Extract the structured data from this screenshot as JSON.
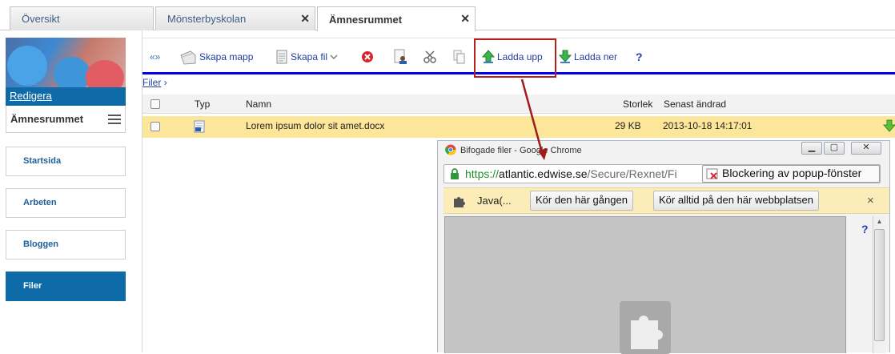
{
  "tabs": [
    {
      "label": "Översikt",
      "closable": false,
      "active": false
    },
    {
      "label": "Mönsterbyskolan",
      "closable": true,
      "active": false
    },
    {
      "label": "Ämnesrummet",
      "closable": true,
      "active": true
    }
  ],
  "tab_close_glyph": "✕",
  "sidebar": {
    "edit_label": "Redigera",
    "room_name": "Ämnesrummet",
    "nav": [
      {
        "label": "Startsida",
        "active": false
      },
      {
        "label": "Arbeten",
        "active": false
      },
      {
        "label": "Bloggen",
        "active": false
      },
      {
        "label": "Filer",
        "active": true
      }
    ]
  },
  "toolbar": {
    "collapse_glyph": "«»",
    "create_folder": "Skapa mapp",
    "create_file": "Skapa fil",
    "upload": "Ladda upp",
    "download": "Ladda ner",
    "help": "?"
  },
  "breadcrumb": {
    "root": "Filer",
    "separator": "›"
  },
  "table": {
    "headers": {
      "type": "Typ",
      "name": "Namn",
      "size": "Storlek",
      "modified": "Senast ändrad"
    },
    "rows": [
      {
        "name": "Lorem ipsum dolor sit amet.docx",
        "size": "29 KB",
        "modified": "2013-10-18 14:17:01",
        "selected": true
      }
    ]
  },
  "popup": {
    "title": "Bifogade filer - Google Chrome",
    "url_scheme": "https://",
    "url_domain": "atlantic.edwise.se",
    "url_path": "/Secure/Rexnet/Fi",
    "popup_blocked": "Blockering av popup-fönster",
    "plugin_name": "Java(...",
    "run_once": "Kör den här gången",
    "run_always": "Kör alltid på den här webbplatsen",
    "dismiss": "×",
    "help": "?"
  },
  "colors": {
    "accent_blue": "#0f6aa8",
    "toolbar_line": "#0000ee",
    "selected_row": "#fce69a",
    "highlight_red": "#b41f1f",
    "infobar_bg": "#fcedb8"
  }
}
